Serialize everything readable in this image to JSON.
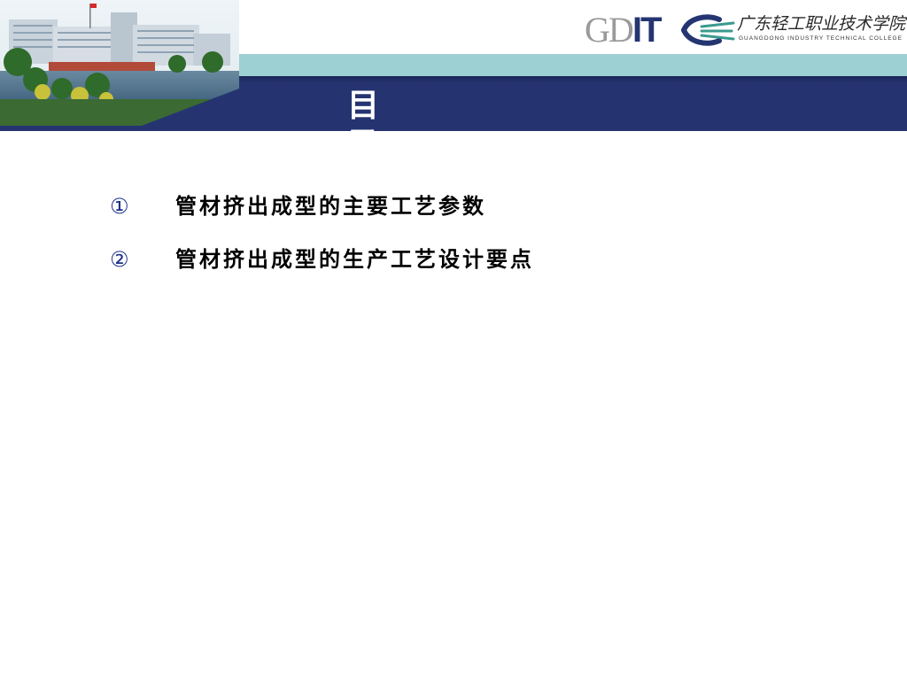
{
  "slide": {
    "title": "目　　录",
    "items": [
      {
        "number": "①",
        "text": "管材挤出成型的主要工艺参数"
      },
      {
        "number": "②",
        "text": "管材挤出成型的生产工艺设计要点"
      }
    ]
  },
  "logo": {
    "gd": "GD",
    "it": "IT",
    "chinese_name": "广东轻工职业技术学院",
    "english_name": "GUANGDONG INDUSTRY TECHNICAL COLLEGE"
  },
  "colors": {
    "navy": "#253471",
    "teal": "#9dd0d2",
    "list_number": "#1c2f8c",
    "logo_swoosh": "#3a9a8f"
  },
  "icons": {
    "photo": "campus-photo",
    "logo": "college-logo-swoosh"
  }
}
